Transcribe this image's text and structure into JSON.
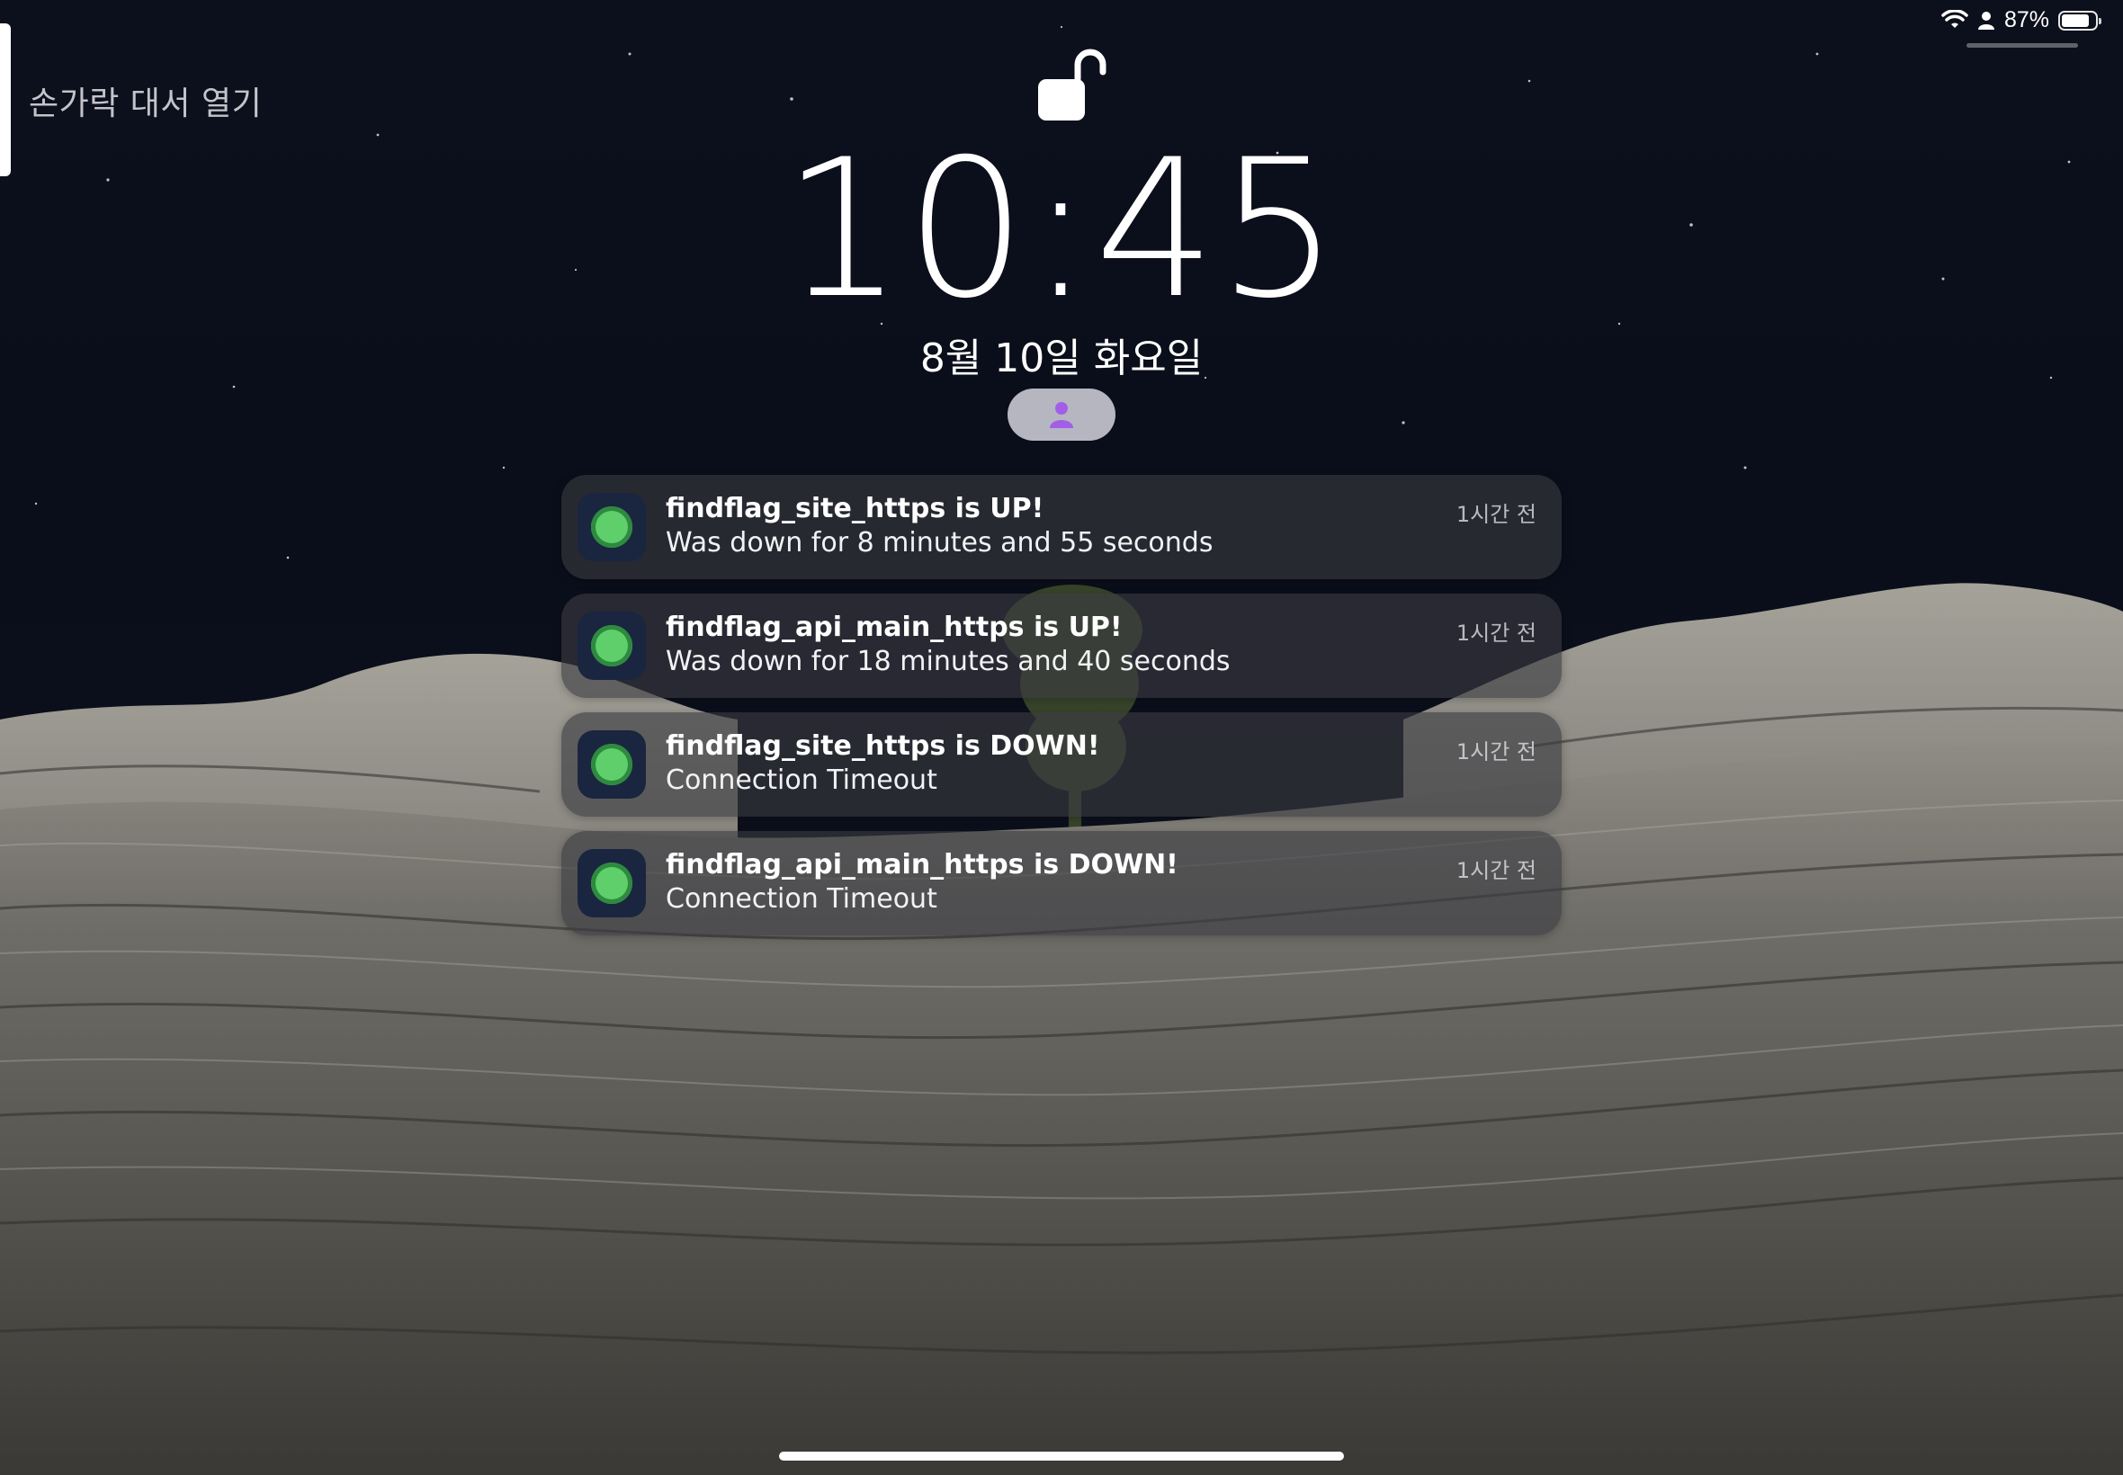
{
  "status_bar": {
    "battery_percent_text": "87%",
    "battery_level": 0.87,
    "icons": [
      "wifi-icon",
      "person-icon",
      "battery-icon"
    ]
  },
  "side_hint": {
    "text": "손가락 대서 열기"
  },
  "lock": {
    "icon": "unlocked-padlock-icon"
  },
  "clock": {
    "time": "10:45",
    "date": "8월 10일 화요일"
  },
  "focus": {
    "icon": "person-icon",
    "color": "#a35ee8"
  },
  "notifications": [
    {
      "title": "findflag_site_https is UP!",
      "body": "Was down for 8 minutes and 55 seconds",
      "time": "1시간 전"
    },
    {
      "title": "findflag_api_main_https is UP!",
      "body": "Was down for 18 minutes and 40 seconds",
      "time": "1시간 전"
    },
    {
      "title": "findflag_site_https is DOWN!",
      "body": "Connection Timeout",
      "time": "1시간 전"
    },
    {
      "title": "findflag_api_main_https is DOWN!",
      "body": "Connection Timeout",
      "time": "1시간 전"
    }
  ]
}
